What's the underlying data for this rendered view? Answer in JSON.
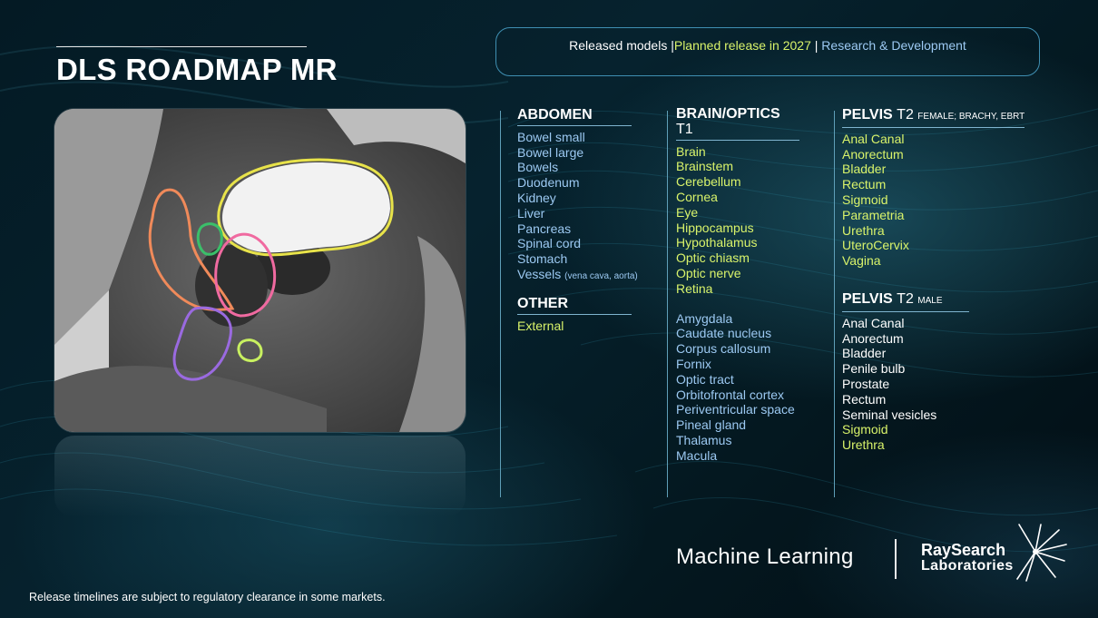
{
  "title": "DLS ROADMAP MR",
  "legend": {
    "released": "Released models |",
    "planned": "Planned release in 2027",
    "separator": " | ",
    "rnd": "Research & Development"
  },
  "colors": {
    "released": "#ffffff",
    "planned": "#d9f36a",
    "rnd": "#9cc9f2",
    "accent_line": "#3f8fb2"
  },
  "abdomen": {
    "title": "ABDOMEN",
    "items": [
      "Bowel small",
      "Bowel large",
      "Bowels",
      "Duodenum",
      "Kidney",
      "Liver",
      "Pancreas",
      "Spinal cord",
      "Stomach"
    ],
    "vessels": "Vessels",
    "vessels_note": "(vena cava, aorta)"
  },
  "other": {
    "title": "OTHER",
    "items": [
      "External"
    ]
  },
  "brain": {
    "title_bold": "BRAIN/OPTICS",
    "title_thin": "T1",
    "planned_items": [
      "Brain",
      "Brainstem",
      "Cerebellum",
      "Cornea",
      "Eye",
      "Hippocampus",
      "Hypothalamus",
      "Optic chiasm",
      "Optic nerve",
      "Retina"
    ],
    "rnd_items": [
      "Amygdala",
      "Caudate nucleus",
      "Corpus callosum",
      "Fornix",
      "Optic tract",
      "Orbitofrontal cortex",
      "Periventricular space",
      "Pineal gland",
      "Thalamus",
      "Macula"
    ]
  },
  "pelvis_female": {
    "title_bold": "PELVIS",
    "title_thin": "T2",
    "title_tiny": "FEMALE; BRACHY, EBRT",
    "items": [
      "Anal Canal",
      "Anorectum",
      "Bladder",
      "Rectum",
      "Sigmoid",
      "Parametria",
      "Urethra",
      "UteroCervix",
      "Vagina"
    ]
  },
  "pelvis_male": {
    "title_bold": "PELVIS",
    "title_thin": "T2",
    "title_tiny": "MALE",
    "released_items": [
      "Anal Canal",
      "Anorectum",
      "Bladder",
      "Penile bulb",
      "Prostate",
      "Rectum",
      "Seminal vesicles"
    ],
    "planned_items": [
      "Sigmoid",
      "Urethra"
    ]
  },
  "footnote": "Release timelines are subject to regulatory clearance in some markets.",
  "machine_learning": "Machine Learning",
  "brand": {
    "line1": "RaySearch",
    "line2": "Laboratories"
  },
  "icons": [
    "raysearch-star-logo"
  ]
}
